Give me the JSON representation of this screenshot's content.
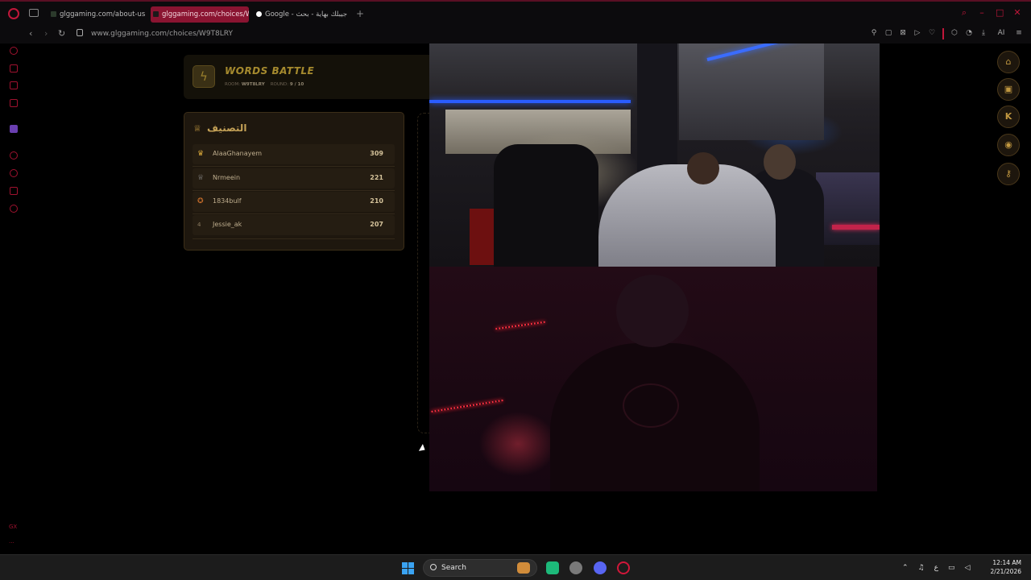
{
  "browser": {
    "tabs": [
      {
        "label": "glggaming.com/about-us",
        "active": false
      },
      {
        "label": "glggaming.com/choices/W",
        "active": true
      },
      {
        "label": "Google - جيبلك بهاية - بحث",
        "active": false
      }
    ],
    "new_tab": "+",
    "url": "www.glggaming.com/choices/W9T8LRY",
    "toolbar_ai_label": "AI",
    "accent_color": "#c0173a"
  },
  "sidebar": {
    "bottom_label_gx": "GX",
    "more": "..."
  },
  "game": {
    "title": "WORDS BATTLE",
    "room_label": "ROOM:",
    "room_code": "W9T8LRY",
    "round_label": "ROUND:",
    "round_value": "9 / 10"
  },
  "leaderboard": {
    "title": "التصنيف",
    "rows": [
      {
        "rank_icon": "crown-icon",
        "name": "AlaaGhanayem",
        "score": "309"
      },
      {
        "rank_icon": "trophy-icon",
        "name": "Nrmeein",
        "score": "221"
      },
      {
        "rank_icon": "medal-icon",
        "name": "1834bulf",
        "score": "210"
      },
      {
        "rank_icon": "4",
        "name": "Jessie_ak",
        "score": "207"
      }
    ]
  },
  "right_nav": [
    "home-icon",
    "gamepad-icon",
    "kick-icon",
    "discord-icon",
    "key-icon"
  ],
  "right_nav_k": "K",
  "taskbar": {
    "search_label": "Search",
    "clock_time": "12:14 AM",
    "clock_date": "2/21/2026",
    "lang": "ع"
  }
}
